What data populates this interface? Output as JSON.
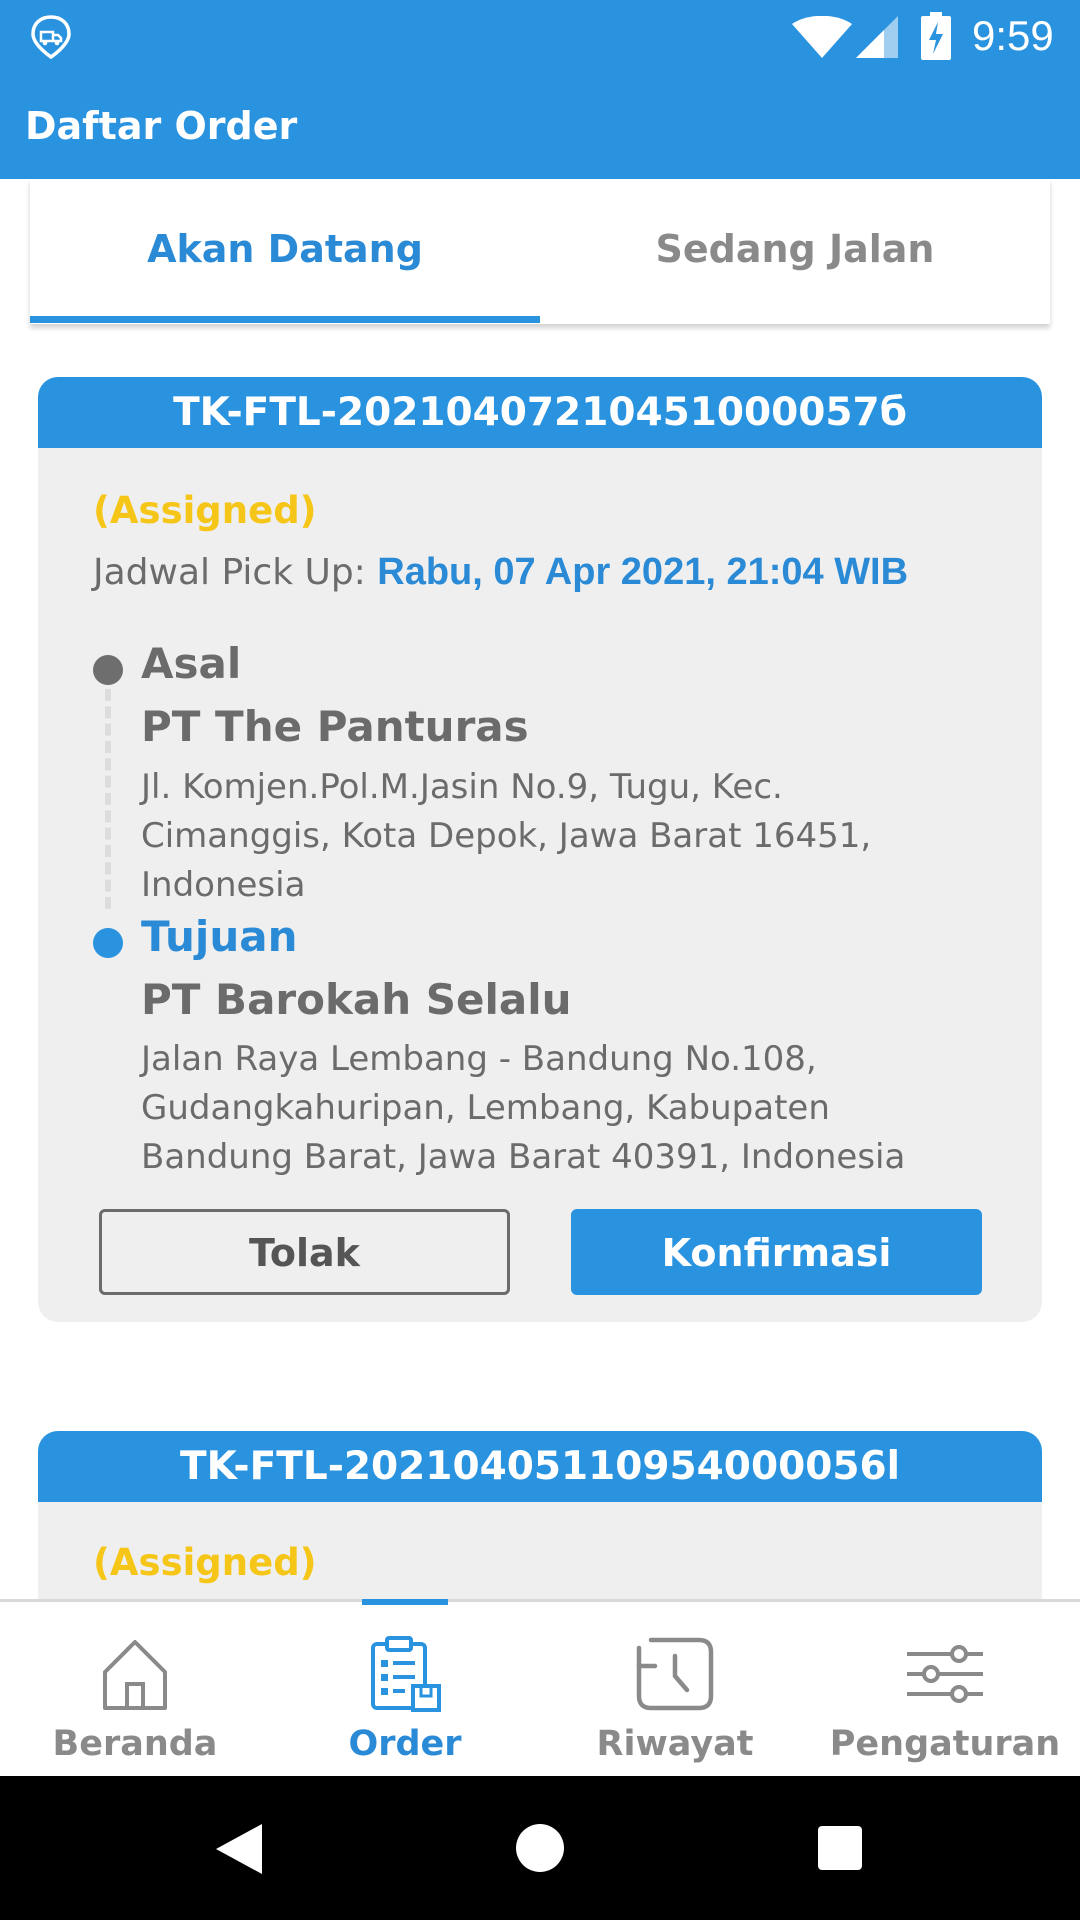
{
  "status_bar": {
    "time": "9:59",
    "icons": [
      "app-logo-icon",
      "wifi-icon",
      "signal-icon",
      "battery-charging-icon"
    ]
  },
  "app_bar": {
    "title": "Daftar Order"
  },
  "tabs": [
    {
      "label": "Akan Datang",
      "active": true
    },
    {
      "label": "Sedang Jalan",
      "active": false
    }
  ],
  "orders": [
    {
      "id": "TK-FTL-20210407210451000057б",
      "status": "(Assigned)",
      "pickup_label": "Jadwal Pick Up: ",
      "pickup_value": "Rabu, 07 Apr 2021, 21:04 WIB",
      "origin_label": "Asal",
      "origin_name": "PT The Panturas",
      "origin_address": "Jl. Komjen.Pol.M.Jasin No.9, Tugu, Kec. Cimanggis, Kota Depok, Jawa Barat 16451, Indonesia",
      "destination_label": "Tujuan",
      "destination_name": "PT Barokah Selalu",
      "destination_address": "Jalan Raya Lembang - Bandung No.108, Gudangkahuripan, Lembang, Kabupaten Bandung Barat, Jawa Barat 40391, Indonesia",
      "reject_label": "Tolak",
      "confirm_label": "Konfirmasi"
    },
    {
      "id": "TK-FTL-20210405110954000056l",
      "status": "(Assigned)"
    }
  ],
  "bottom_nav": [
    {
      "label": "Beranda",
      "icon": "home-icon",
      "active": false
    },
    {
      "label": "Order",
      "icon": "order-clipboard-icon",
      "active": true
    },
    {
      "label": "Riwayat",
      "icon": "history-icon",
      "active": false
    },
    {
      "label": "Pengaturan",
      "icon": "settings-sliders-icon",
      "active": false
    }
  ],
  "colors": {
    "primary": "#2a93e0",
    "status_assigned": "#f5c518",
    "text": "#6b6b6b",
    "card_bg": "#efefef"
  }
}
